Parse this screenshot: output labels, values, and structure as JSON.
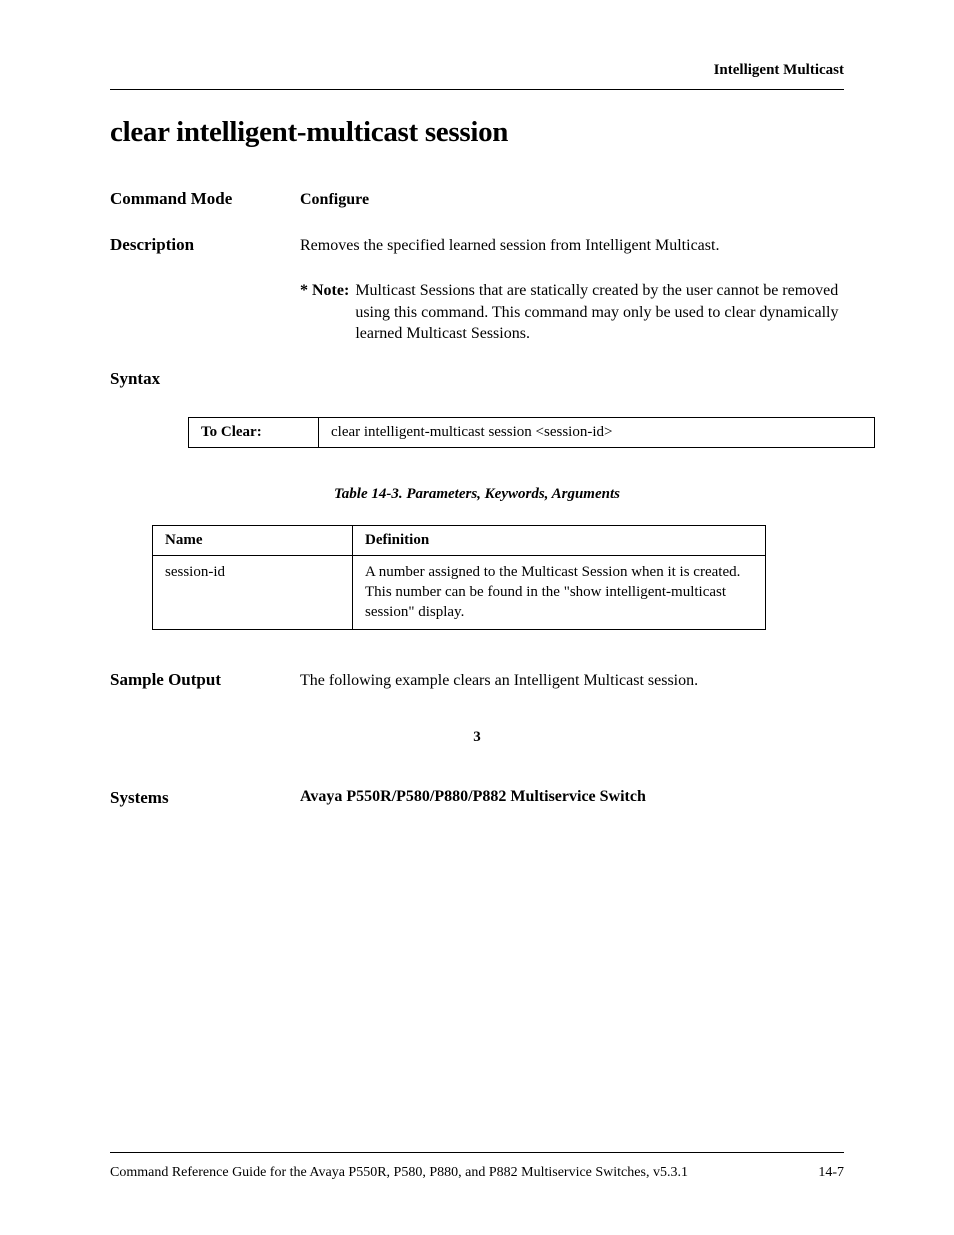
{
  "header": {
    "section": "Intelligent Multicast"
  },
  "title": "clear intelligent-multicast session",
  "command_mode": {
    "label": "Command Mode",
    "value": "Configure"
  },
  "description": {
    "label": "Description",
    "text": "Removes the specified learned session from Intelligent Multicast.",
    "note_label": "* Note:",
    "note_text": "Multicast Sessions that are statically created by the user cannot be removed using this command. This command may only be used to clear dynamically learned Multicast Sessions."
  },
  "syntax": {
    "label": "Syntax",
    "action": "To Clear:",
    "command": "clear intelligent-multicast session <session-id>"
  },
  "table_caption": "Table 14-3.   Parameters, Keywords, Arguments",
  "params_table": {
    "headers": {
      "name": "Name",
      "definition": "Definition"
    },
    "rows": [
      {
        "name": "session-id",
        "definition": "A number assigned to the Multicast Session when it is created. This number can be found in the \"show intelligent-multicast session\" display."
      }
    ]
  },
  "sample_output": {
    "label": "Sample Output",
    "text": "The following example clears an Intelligent Multicast session.",
    "number": "3"
  },
  "systems": {
    "label": "Systems",
    "value": "Avaya P550R/P580/P880/P882 Multiservice Switch"
  },
  "footer": {
    "guide": "Command Reference Guide for the Avaya P550R, P580, P880, and P882 Multiservice Switches, v5.3.1",
    "page": "14-7"
  }
}
